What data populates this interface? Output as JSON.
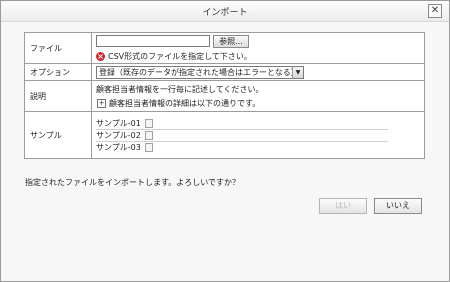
{
  "dialog": {
    "title": "インポート",
    "close_icon": "close-icon"
  },
  "form": {
    "file": {
      "label": "ファイル",
      "value": "",
      "browse_label": "参照...",
      "error_icon": "error-icon",
      "error_text": "CSV形式のファイルを指定して下さい。"
    },
    "option": {
      "label": "オプション",
      "selected": "登録（既存のデータが指定された場合はエラーとなる）"
    },
    "description": {
      "label": "説明",
      "text": "顧客担当者情報を一行毎に記述してください。",
      "detail_text": "顧客担当者情報の詳細は以下の通りです。"
    },
    "sample": {
      "label": "サンプル",
      "items": [
        "サンプル-01",
        "サンプル-02",
        "サンプル-03"
      ]
    }
  },
  "confirm_text": "指定されたファイルをインポートします。よろしいですか？",
  "buttons": {
    "yes": "はい",
    "no": "いいえ"
  }
}
